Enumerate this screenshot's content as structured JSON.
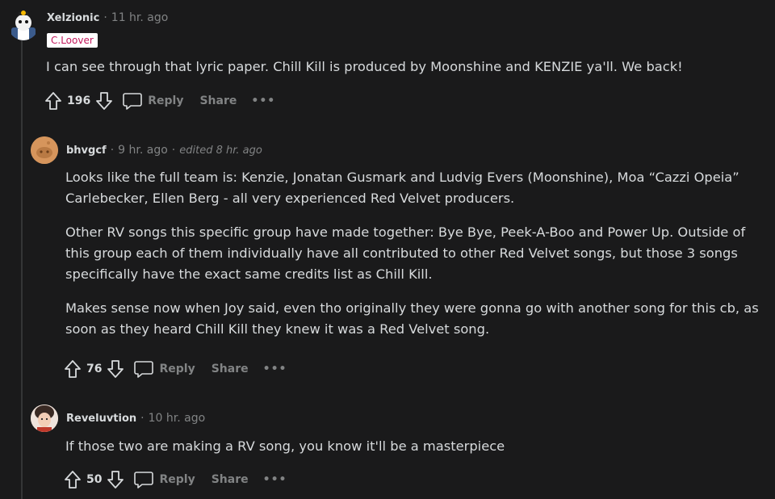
{
  "comments": [
    {
      "username": "Xelzionic",
      "time": "11 hr. ago",
      "flair": "C.Loover",
      "body": [
        "I can see through that lyric paper. Chill Kill is produced by Moonshine and KENZIE ya'll. We back!"
      ],
      "score": "196",
      "reply": "Reply",
      "share": "Share",
      "more": "•••"
    },
    {
      "username": "bhvgcf",
      "time": "9 hr. ago",
      "edited": "edited 8 hr. ago",
      "body": [
        "Looks like the full team is: Kenzie, Jonatan Gusmark and Ludvig Evers (Moonshine), Moa “Cazzi Opeia” Carlebecker, Ellen Berg - all very experienced Red Velvet producers.",
        "Other RV songs this specific group have made together: Bye Bye, Peek-A-Boo and Power Up. Outside of this group each of them individually have all contributed to other Red Velvet songs, but those 3 songs specifically have the exact same credits list as Chill Kill.",
        "Makes sense now when Joy said, even tho originally they were gonna go with another song for this cb, as soon as they heard Chill Kill they knew it was a Red Velvet song."
      ],
      "score": "76",
      "reply": "Reply",
      "share": "Share",
      "more": "•••"
    },
    {
      "username": "Reveluvtion",
      "time": "10 hr. ago",
      "body": [
        "If those two are making a RV song, you know it'll be a masterpiece"
      ],
      "score": "50",
      "reply": "Reply",
      "share": "Share",
      "more": "•••"
    }
  ],
  "colors": {
    "background": "#1a1a1b",
    "text": "#d7dadc",
    "muted": "#818384",
    "flair_bg": "#ffffff",
    "flair_text": "#c2185b"
  }
}
